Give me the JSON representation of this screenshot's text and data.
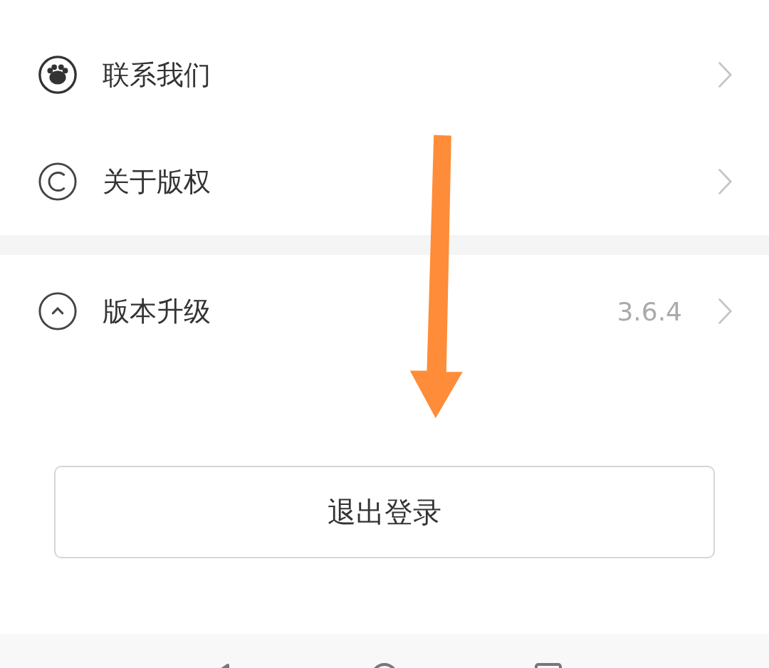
{
  "menu_groups": [
    {
      "items": [
        {
          "label": "联系我们"
        },
        {
          "label": "关于版权"
        }
      ]
    },
    {
      "items": [
        {
          "label": "版本升级",
          "value": "3.6.4"
        }
      ]
    }
  ],
  "logout_button": {
    "label": "退出登录"
  }
}
